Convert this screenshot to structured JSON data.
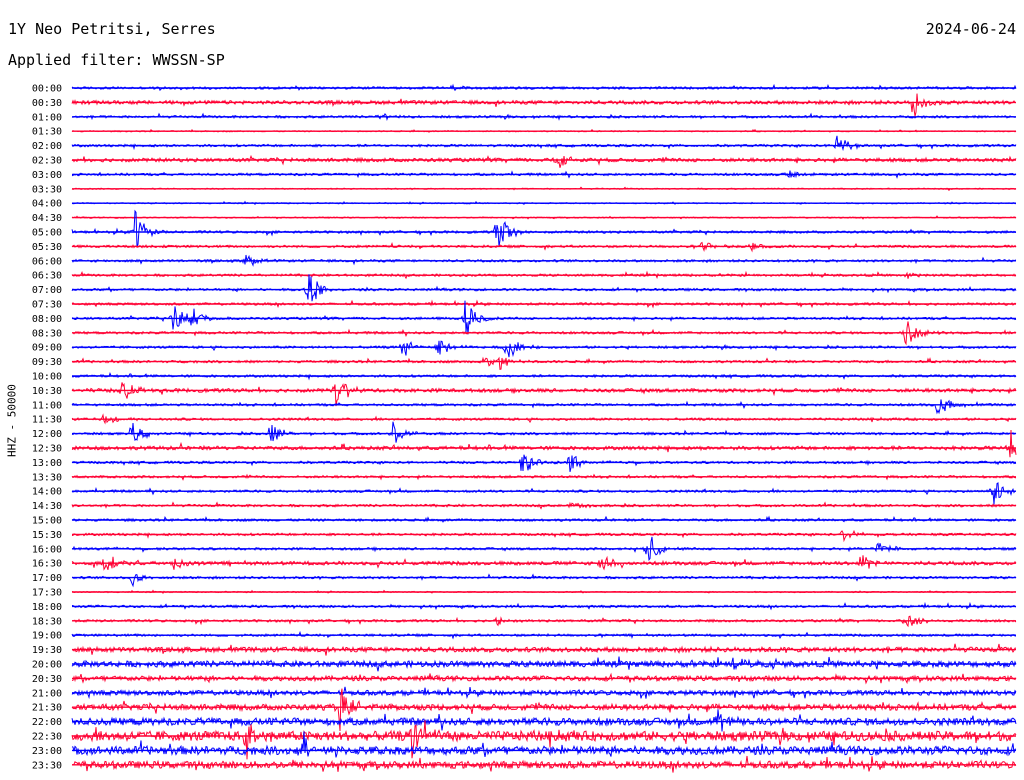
{
  "header": {
    "station": "1Y Neo Petritsi, Serres",
    "date": "2024-06-24",
    "filter": "Applied filter: WWSSN-SP"
  },
  "colors": {
    "even_trace": "#0000ff",
    "odd_trace": "#ff0033",
    "background": "#ffffff"
  },
  "chart_data": {
    "type": "line",
    "ylabel": "HHZ - 50000",
    "categories": [
      "00:00",
      "00:30",
      "01:00",
      "01:30",
      "02:00",
      "02:30",
      "03:00",
      "03:30",
      "04:00",
      "04:30",
      "05:00",
      "05:30",
      "06:00",
      "06:30",
      "07:00",
      "07:30",
      "08:00",
      "08:30",
      "09:00",
      "09:30",
      "10:00",
      "10:30",
      "11:00",
      "11:30",
      "12:00",
      "12:30",
      "13:00",
      "13:30",
      "14:00",
      "14:30",
      "15:00",
      "15:30",
      "16:00",
      "16:30",
      "17:00",
      "17:30",
      "18:00",
      "18:30",
      "19:00",
      "19:30",
      "20:00",
      "20:30",
      "21:00",
      "21:30",
      "22:00",
      "22:30",
      "23:00",
      "23:30"
    ],
    "trace_minutes": 30,
    "noise_level": [
      2,
      3,
      2,
      1,
      2,
      3,
      2,
      1,
      1,
      1,
      2,
      2,
      2,
      2,
      2,
      2,
      2,
      2,
      2,
      2,
      2,
      3,
      2,
      2,
      2,
      3,
      2,
      2,
      2,
      2,
      2,
      2,
      2,
      3,
      2,
      1,
      2,
      2,
      2,
      4,
      5,
      4,
      4,
      5,
      6,
      8,
      7,
      6
    ],
    "events": [
      {
        "trace": "00:00",
        "minute": 12.0,
        "amplitude": 3
      },
      {
        "trace": "00:30",
        "minute": 26.7,
        "amplitude": 18
      },
      {
        "trace": "01:00",
        "minute": 9.8,
        "amplitude": 4
      },
      {
        "trace": "02:00",
        "minute": 24.3,
        "amplitude": 14
      },
      {
        "trace": "02:30",
        "minute": 15.4,
        "amplitude": 9
      },
      {
        "trace": "03:00",
        "minute": 22.8,
        "amplitude": 5
      },
      {
        "trace": "05:00",
        "minute": 2.0,
        "amplitude": 22
      },
      {
        "trace": "05:00",
        "minute": 13.5,
        "amplitude": 24
      },
      {
        "trace": "05:30",
        "minute": 20.0,
        "amplitude": 7
      },
      {
        "trace": "05:30",
        "minute": 21.6,
        "amplitude": 6
      },
      {
        "trace": "06:00",
        "minute": 5.5,
        "amplitude": 10
      },
      {
        "trace": "06:30",
        "minute": 26.5,
        "amplitude": 4
      },
      {
        "trace": "07:00",
        "minute": 7.5,
        "amplitude": 22
      },
      {
        "trace": "08:00",
        "minute": 3.2,
        "amplitude": 18
      },
      {
        "trace": "08:00",
        "minute": 3.8,
        "amplitude": 14
      },
      {
        "trace": "08:00",
        "minute": 12.5,
        "amplitude": 22
      },
      {
        "trace": "08:30",
        "minute": 26.5,
        "amplitude": 18
      },
      {
        "trace": "09:00",
        "minute": 10.5,
        "amplitude": 12
      },
      {
        "trace": "09:00",
        "minute": 11.6,
        "amplitude": 14
      },
      {
        "trace": "09:00",
        "minute": 13.8,
        "amplitude": 16
      },
      {
        "trace": "09:30",
        "minute": 13.1,
        "amplitude": 8
      },
      {
        "trace": "09:30",
        "minute": 13.6,
        "amplitude": 10
      },
      {
        "trace": "10:30",
        "minute": 1.6,
        "amplitude": 12
      },
      {
        "trace": "10:30",
        "minute": 8.4,
        "amplitude": 20
      },
      {
        "trace": "11:00",
        "minute": 27.5,
        "amplitude": 12
      },
      {
        "trace": "11:30",
        "minute": 1.0,
        "amplitude": 8
      },
      {
        "trace": "12:00",
        "minute": 1.9,
        "amplitude": 14
      },
      {
        "trace": "12:00",
        "minute": 6.3,
        "amplitude": 12
      },
      {
        "trace": "12:00",
        "minute": 10.2,
        "amplitude": 12
      },
      {
        "trace": "12:30",
        "minute": 29.8,
        "amplitude": 24
      },
      {
        "trace": "13:00",
        "minute": 14.3,
        "amplitude": 14
      },
      {
        "trace": "13:00",
        "minute": 15.8,
        "amplitude": 10
      },
      {
        "trace": "14:00",
        "minute": 29.3,
        "amplitude": 18
      },
      {
        "trace": "14:30",
        "minute": 15.9,
        "amplitude": 5
      },
      {
        "trace": "15:30",
        "minute": 24.5,
        "amplitude": 8
      },
      {
        "trace": "16:00",
        "minute": 18.3,
        "amplitude": 18
      },
      {
        "trace": "16:00",
        "minute": 25.6,
        "amplitude": 8
      },
      {
        "trace": "16:30",
        "minute": 1.0,
        "amplitude": 14
      },
      {
        "trace": "16:30",
        "minute": 3.2,
        "amplitude": 12
      },
      {
        "trace": "16:30",
        "minute": 16.8,
        "amplitude": 10
      },
      {
        "trace": "16:30",
        "minute": 25.0,
        "amplitude": 12
      },
      {
        "trace": "17:00",
        "minute": 1.9,
        "amplitude": 10
      },
      {
        "trace": "18:30",
        "minute": 13.5,
        "amplitude": 6
      },
      {
        "trace": "18:30",
        "minute": 26.5,
        "amplitude": 12
      },
      {
        "trace": "20:00",
        "minute": 21.0,
        "amplitude": 8
      },
      {
        "trace": "21:30",
        "minute": 8.5,
        "amplitude": 30
      },
      {
        "trace": "22:00",
        "minute": 20.5,
        "amplitude": 12
      },
      {
        "trace": "22:30",
        "minute": 5.5,
        "amplitude": 18
      },
      {
        "trace": "22:30",
        "minute": 10.8,
        "amplitude": 26
      },
      {
        "trace": "23:00",
        "minute": 7.3,
        "amplitude": 16
      }
    ]
  }
}
